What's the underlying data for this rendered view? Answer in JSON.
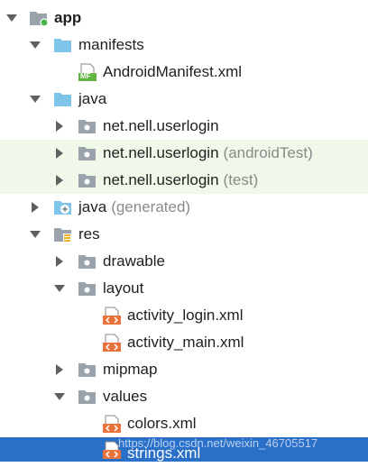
{
  "tree": {
    "app": "app",
    "manifests": "manifests",
    "android_manifest": "AndroidManifest.xml",
    "java": "java",
    "pkg_main": "net.nell.userlogin",
    "pkg_android_test": "net.nell.userlogin",
    "pkg_android_test_suffix": "(androidTest)",
    "pkg_test": "net.nell.userlogin",
    "pkg_test_suffix": "(test)",
    "java_generated": "java",
    "java_generated_suffix": "(generated)",
    "res": "res",
    "drawable": "drawable",
    "layout": "layout",
    "activity_login": "activity_login.xml",
    "activity_main": "activity_main.xml",
    "mipmap": "mipmap",
    "values": "values",
    "colors": "colors.xml",
    "strings": "strings.xml"
  },
  "icons": {
    "manifest_badge": "MF"
  },
  "watermark": "https://blog.csdn.net/weixin_46705517",
  "colors": {
    "folder_blue": "#7ec4e8",
    "folder_gray": "#9aa3ab",
    "selection": "#2a70c9",
    "highlight_green": "#eff8e9",
    "xml_orange": "#e8733d",
    "suffix_gray": "#8a8a8a"
  }
}
